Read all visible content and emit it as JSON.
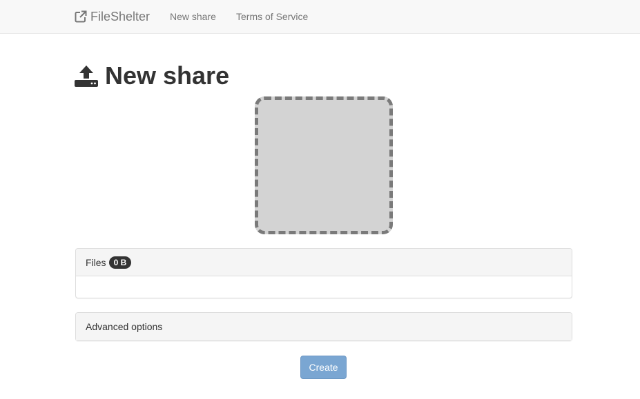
{
  "navbar": {
    "brand": "FileShelter",
    "brand_icon": "external-link-icon",
    "links": [
      "New share",
      "Terms of Service"
    ]
  },
  "main": {
    "title": "New share",
    "title_icon": "upload-icon",
    "dropzone": {
      "background": "#d3d3d3",
      "border_color": "#7a7a7a"
    },
    "files_panel": {
      "label": "Files",
      "size_badge": "0 B"
    },
    "advanced_panel": {
      "label": "Advanced options"
    },
    "create_button": {
      "label": "Create",
      "state": "disabled",
      "color": "#7aa6d2"
    }
  }
}
